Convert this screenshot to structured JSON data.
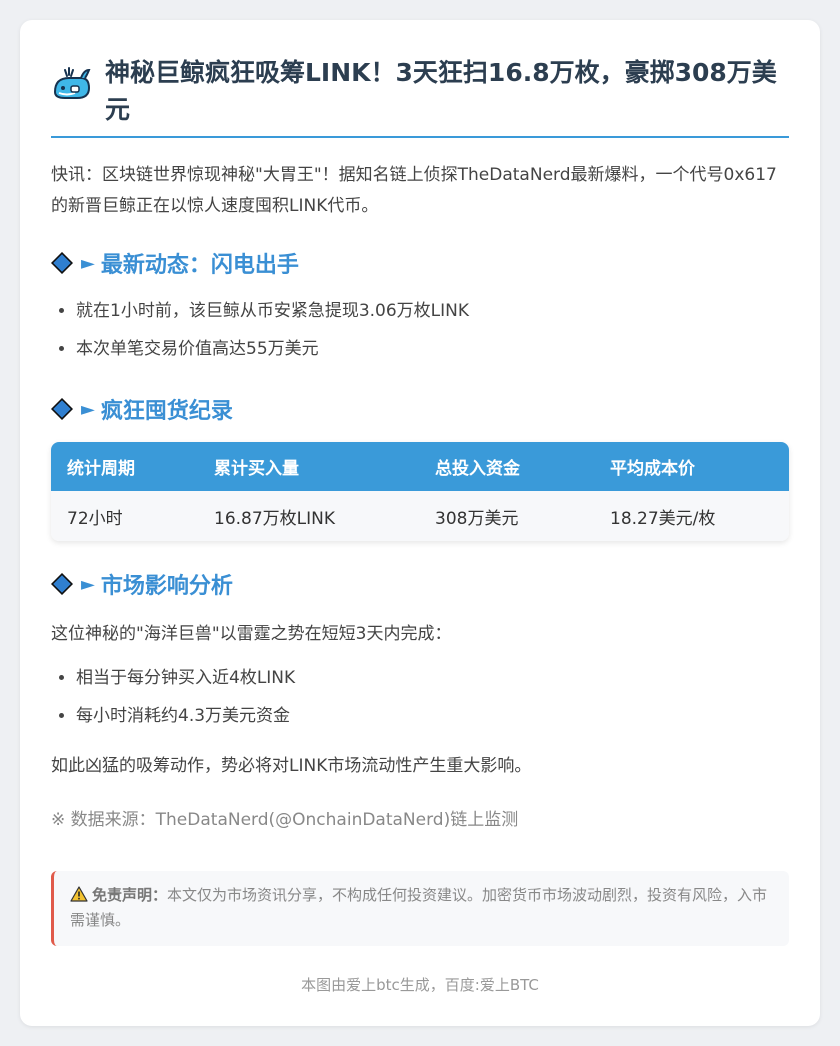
{
  "article": {
    "title": "神秘巨鲸疯狂吸筹LINK！3天狂扫16.8万枚，豪掷308万美元",
    "intro": "快讯：区块链世界惊现神秘\"大胃王\"！据知名链上侦探TheDataNerd最新爆料，一个代号0x617的新晋巨鲸正在以惊人速度囤积LINK代币。"
  },
  "section1": {
    "arrow": "►",
    "title": "最新动态：闪电出手",
    "items": [
      "就在1小时前，该巨鲸从币安紧急提现3.06万枚LINK",
      "本次单笔交易价值高达55万美元"
    ]
  },
  "section2": {
    "arrow": "►",
    "title": "疯狂囤货纪录",
    "table": {
      "headers": [
        "统计周期",
        "累计买入量",
        "总投入资金",
        "平均成本价"
      ],
      "row": [
        "72小时",
        "16.87万枚LINK",
        "308万美元",
        "18.27美元/枚"
      ]
    }
  },
  "section3": {
    "arrow": "►",
    "title": "市场影响分析",
    "lead": "这位神秘的\"海洋巨兽\"以雷霆之势在短短3天内完成：",
    "items": [
      "相当于每分钟买入近4枚LINK",
      "每小时消耗约4.3万美元资金"
    ],
    "conclusion": "如此凶猛的吸筹动作，势必将对LINK市场流动性产生重大影响。"
  },
  "source": "※ 数据来源：TheDataNerd(@OnchainDataNerd)链上监测",
  "disclaimer": {
    "label": "免责声明：",
    "text": "本文仅为市场资讯分享，不构成任何投资建议。加密货币市场波动剧烈，投资有风险，入市需谨慎。"
  },
  "footer": "本图由爱上btc生成，百度:爱上BTC",
  "icons": {
    "header": "whale-icon",
    "section": "diamond-icon",
    "disclaimer": "warning-icon"
  },
  "colors": {
    "accent": "#3a9ad9",
    "heading": "#2c3e50",
    "warning_border": "#e05a4a"
  }
}
